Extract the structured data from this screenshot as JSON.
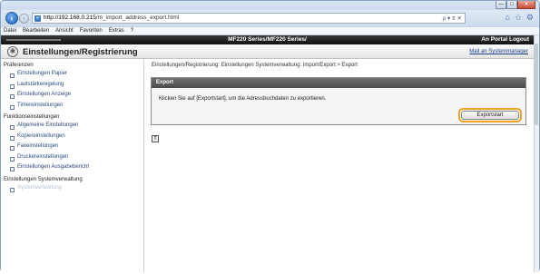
{
  "browser": {
    "url_host": "http://192.168.0.215",
    "url_path": "/m_import_address_export.html",
    "url_tools": "ρ ▾ ¢ ✕",
    "window_controls": {
      "minimize": "—",
      "maximize": "□",
      "close": "✕"
    },
    "nav_back_icon": "back-arrow-icon",
    "nav_forward_icon": "forward-arrow-icon",
    "toolbar_icons": {
      "home": "⌂",
      "favorites": "☆",
      "settings": "⚙"
    }
  },
  "menu": [
    "Datei",
    "Bearbeiten",
    "Ansicht",
    "Favoriten",
    "Extras",
    "?"
  ],
  "header": {
    "product": "MF220 Series/MF220 Series/",
    "portal_link": "An Portal",
    "logout_link": "Logout"
  },
  "banner": {
    "title": "Einstellungen/Registrierung",
    "mail_link": "Mail an Systemmanager"
  },
  "sidebar": {
    "sections": [
      {
        "title": "Präferenzen",
        "items": [
          "Einstellungen Papier",
          "Lautstärkeregelung",
          "Einstellungen Anzeige",
          "Timereinstellungen"
        ]
      },
      {
        "title": "Funktionseinstellungen",
        "items": [
          "Allgemeine Einstellungen",
          "Kopiereinstellungen",
          "Faxeinstellungen",
          "Druckereinstellungen",
          "Einstellungen Ausgabebericht"
        ]
      },
      {
        "title": "Einstellungen Systemverwaltung",
        "items": [
          "Systemverwaltung"
        ]
      }
    ]
  },
  "main": {
    "breadcrumb": "Einstellungen/Registrierung: Einstellungen Systemverwaltung: Import/Export > Export",
    "panel_title": "Export",
    "panel_text": "Klicken Sie auf [Exportstart], um die Adressbuchdaten zu exportieren.",
    "export_button": "Exportstart",
    "top_icon_glyph": "⇑"
  },
  "colors": {
    "header_bg": "#1a1a1a",
    "panel_header_bg": "#5a5a5a",
    "highlight_border": "#f0a52a",
    "link_color": "#2a4a7e"
  }
}
